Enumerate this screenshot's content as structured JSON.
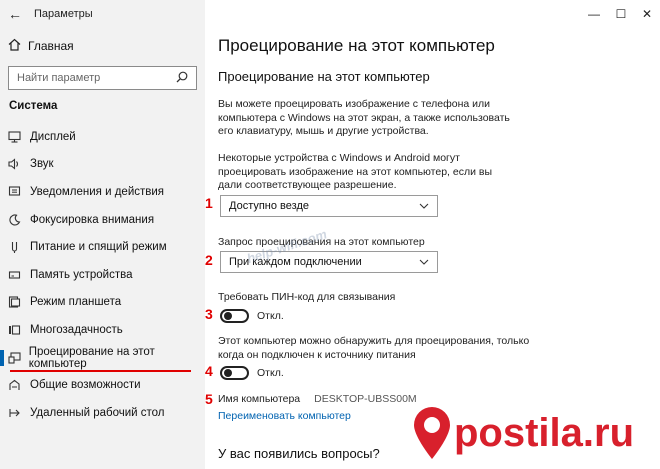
{
  "window": {
    "title": "Параметры",
    "back_glyph": "←",
    "minimize_glyph": "—",
    "maximize_glyph": "☐",
    "close_glyph": "✕"
  },
  "sidebar": {
    "home_label": "Главная",
    "search_placeholder": "Найти параметр",
    "section_title": "Система",
    "items": [
      {
        "label": "Дисплей",
        "icon": "display-icon"
      },
      {
        "label": "Звук",
        "icon": "sound-icon"
      },
      {
        "label": "Уведомления и действия",
        "icon": "notifications-icon"
      },
      {
        "label": "Фокусировка внимания",
        "icon": "focus-assist-icon"
      },
      {
        "label": "Питание и спящий режим",
        "icon": "power-icon"
      },
      {
        "label": "Память устройства",
        "icon": "storage-icon"
      },
      {
        "label": "Режим планшета",
        "icon": "tablet-mode-icon"
      },
      {
        "label": "Многозадачность",
        "icon": "multitasking-icon"
      },
      {
        "label": "Проецирование на этот компьютер",
        "icon": "projecting-icon",
        "active": true
      },
      {
        "label": "Общие возможности",
        "icon": "shared-experiences-icon"
      },
      {
        "label": "Удаленный рабочий стол",
        "icon": "remote-desktop-icon"
      }
    ]
  },
  "main": {
    "page_title": "Проецирование на этот компьютер",
    "section_title": "Проецирование на этот компьютер",
    "intro_text": "Вы можете проецировать изображение с телефона или компьютера с Windows на этот экран, а также использовать его клавиатуру, мышь и другие устройства.",
    "availability_text": "Некоторые устройства с Windows и Android могут проецировать изображение на этот компьютер, если вы дали соответствующее разрешение.",
    "availability_dropdown": "Доступно везде",
    "request_label": "Запрос проецирования на этот компьютер",
    "request_dropdown": "При каждом подключении",
    "pin_label": "Требовать ПИН-код для связывания",
    "pin_toggle_state": "Откл.",
    "power_text": "Этот компьютер можно обнаружить для проецирования, только когда он подключен к источнику питания",
    "power_toggle_state": "Откл.",
    "pc_name_label": "Имя компьютера",
    "pc_name_value": "DESKTOP-UBSS00M",
    "rename_link": "Переименовать компьютер",
    "questions_title": "У вас появились вопросы?"
  },
  "annotations": {
    "steps": [
      "1",
      "2",
      "3",
      "4",
      "5"
    ],
    "color": "#e00000"
  },
  "watermarks": {
    "site": "help-wifi.com",
    "brand": "postila.ru"
  },
  "colors": {
    "accent": "#0063b1",
    "sidebar_bg": "#f2f2f2",
    "brand_red": "#d8202c"
  }
}
